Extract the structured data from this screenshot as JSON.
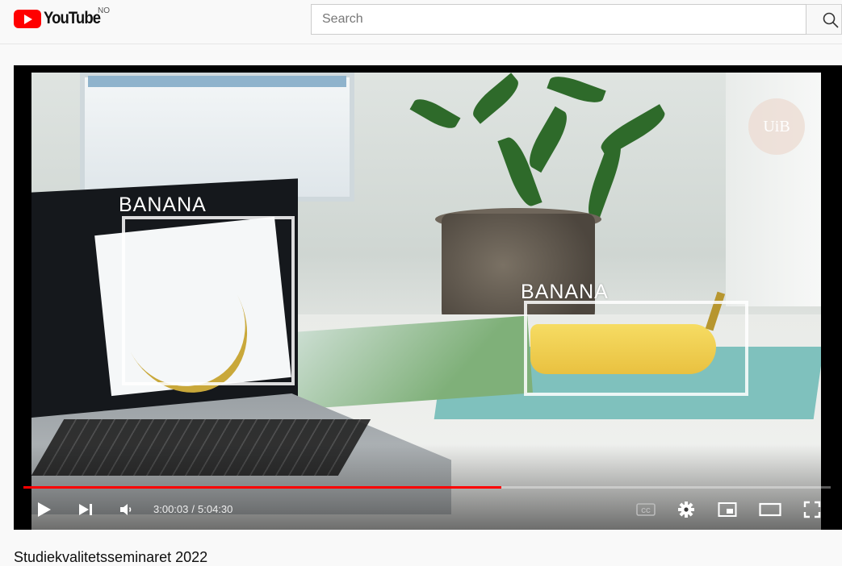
{
  "header": {
    "logo_text": "YouTube",
    "country_code": "NO",
    "search": {
      "placeholder": "Search",
      "value": ""
    }
  },
  "player": {
    "overlay_labels": [
      "BANANA",
      "BANANA"
    ],
    "watermark_text": "UiB",
    "current_time": "3:00:03",
    "duration": "5:04:30",
    "time_separator": "/",
    "progress_fraction": 0.592,
    "colors": {
      "progress": "#ff0000",
      "logo": "#ff0000"
    },
    "controls": [
      {
        "name": "play-icon"
      },
      {
        "name": "next-icon"
      },
      {
        "name": "volume-icon"
      },
      {
        "name": "subtitles-icon"
      },
      {
        "name": "settings-gear-icon"
      },
      {
        "name": "miniplayer-icon"
      },
      {
        "name": "theater-mode-icon"
      },
      {
        "name": "fullscreen-icon"
      }
    ]
  },
  "video": {
    "title": "Studiekvalitetsseminaret 2022"
  }
}
